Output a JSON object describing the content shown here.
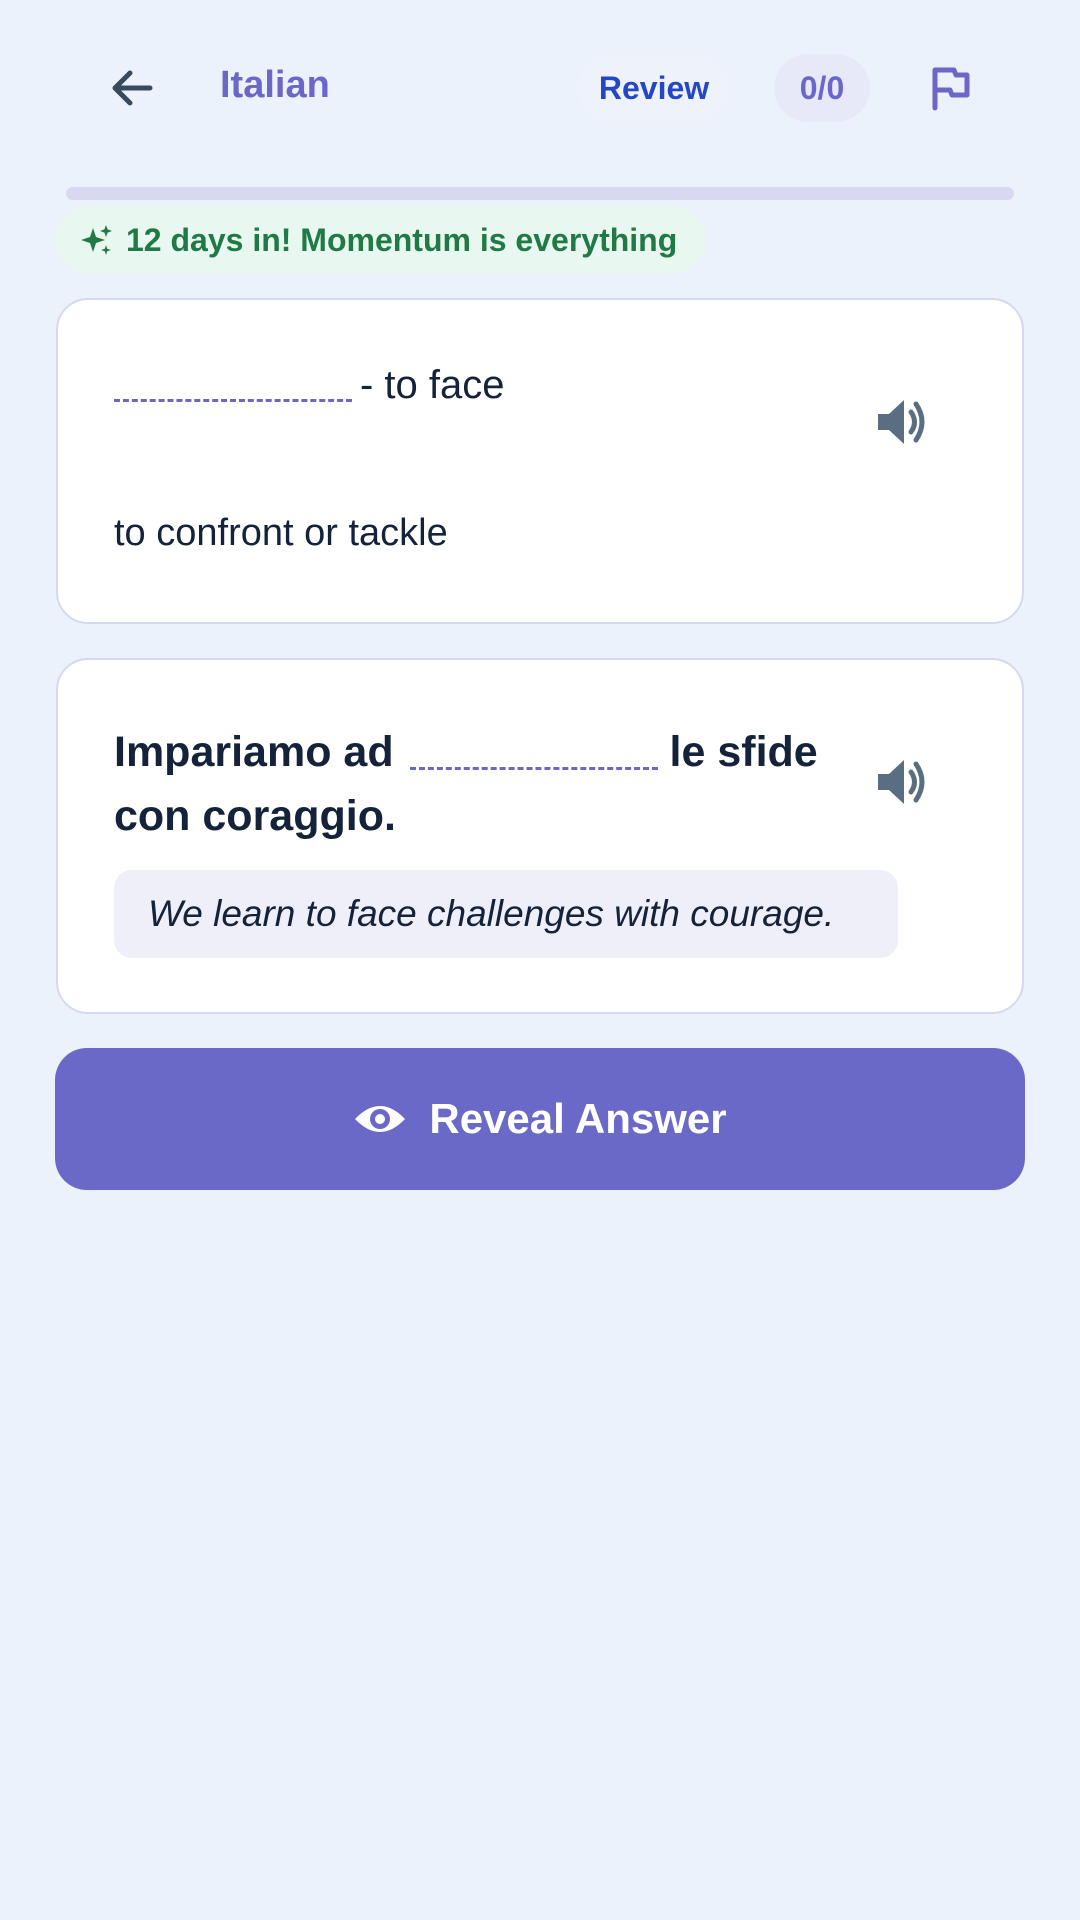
{
  "header": {
    "title": "Italian",
    "review_label": "Review",
    "count": "0/0"
  },
  "progress": {
    "fraction": 0
  },
  "streak": {
    "text": "12 days in! Momentum is everything"
  },
  "definition_card": {
    "term_suffix": "- to face",
    "definition": "to confront or tackle"
  },
  "sentence_card": {
    "before_blank": "Impariamo ad",
    "after_blank": "le sfide con coraggio.",
    "translation": "We learn to face challenges with courage."
  },
  "reveal_button": {
    "label": "Reveal Answer"
  },
  "icons": {
    "back": "arrow-left-icon",
    "flag": "flag-icon",
    "streak": "sparkles-icon",
    "audio": "speaker-icon",
    "reveal": "eye-icon"
  },
  "colors": {
    "accent": "#6b67c6",
    "background": "#ecf2fb",
    "streak_text": "#1f7a45",
    "review_text": "#2448c4"
  }
}
